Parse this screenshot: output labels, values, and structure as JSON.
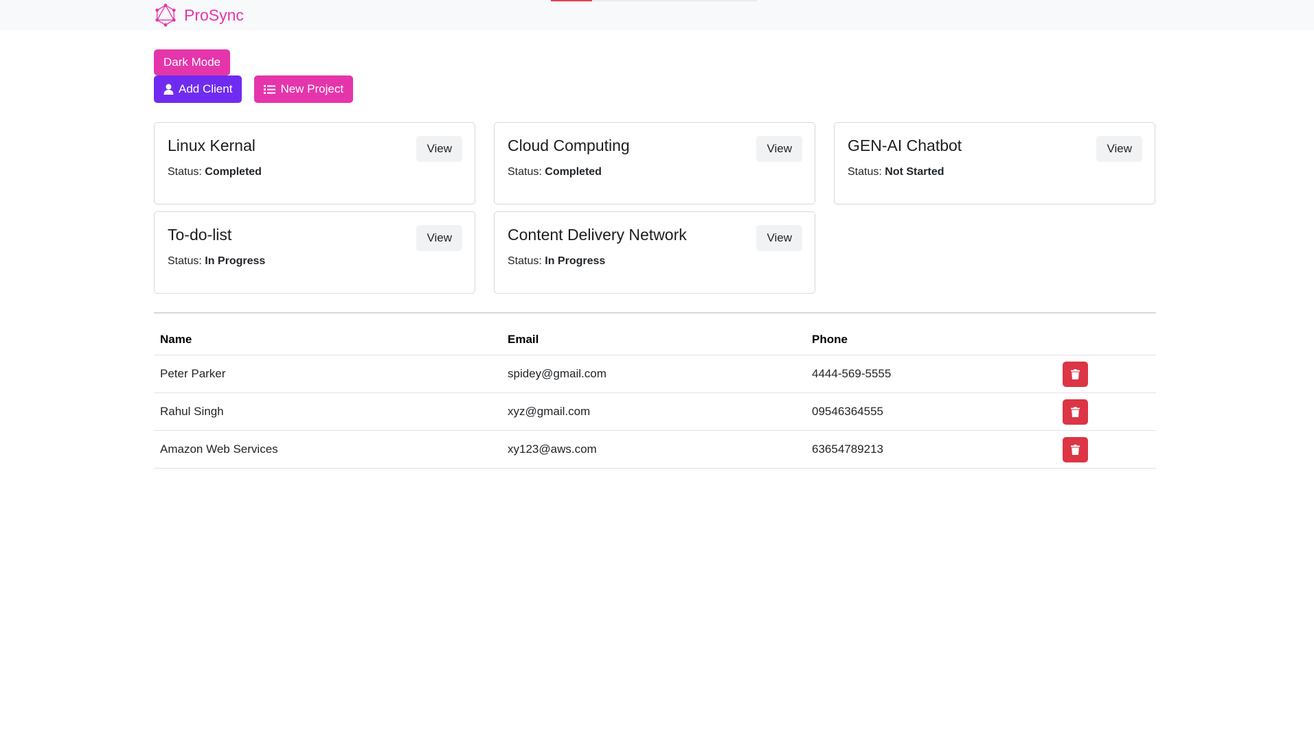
{
  "brand": {
    "name": "ProSync"
  },
  "nav_progress": {
    "fraction": 0.2
  },
  "toolbar": {
    "dark_mode_label": "Dark Mode",
    "add_client_label": "Add Client",
    "new_project_label": "New Project"
  },
  "projects": [
    {
      "title": "Linux Kernal",
      "status_label": "Status:",
      "status": "Completed",
      "view_label": "View"
    },
    {
      "title": "Cloud Computing",
      "status_label": "Status:",
      "status": "Completed",
      "view_label": "View"
    },
    {
      "title": "GEN-AI Chatbot",
      "status_label": "Status:",
      "status": "Not Started",
      "view_label": "View"
    },
    {
      "title": "To-do-list",
      "status_label": "Status:",
      "status": "In Progress",
      "view_label": "View"
    },
    {
      "title": "Content Delivery Network",
      "status_label": "Status:",
      "status": "In Progress",
      "view_label": "View"
    }
  ],
  "clients_table": {
    "headers": {
      "name": "Name",
      "email": "Email",
      "phone": "Phone"
    },
    "rows": [
      {
        "name": "Peter Parker",
        "email": "spidey@gmail.com",
        "phone": "4444-569-5555"
      },
      {
        "name": "Rahul Singh",
        "email": "xyz@gmail.com",
        "phone": "09546364555"
      },
      {
        "name": "Amazon Web Services",
        "email": "xy123@aws.com",
        "phone": "63654789213"
      }
    ]
  },
  "colors": {
    "brand": "#e535ab",
    "purple": "#6f2cf0",
    "danger": "#dc3545",
    "progress": "#e83e52"
  },
  "icons": {
    "logo": "graphql-logo-icon",
    "add_client": "user-icon",
    "new_project": "list-icon",
    "delete": "trash-icon"
  }
}
